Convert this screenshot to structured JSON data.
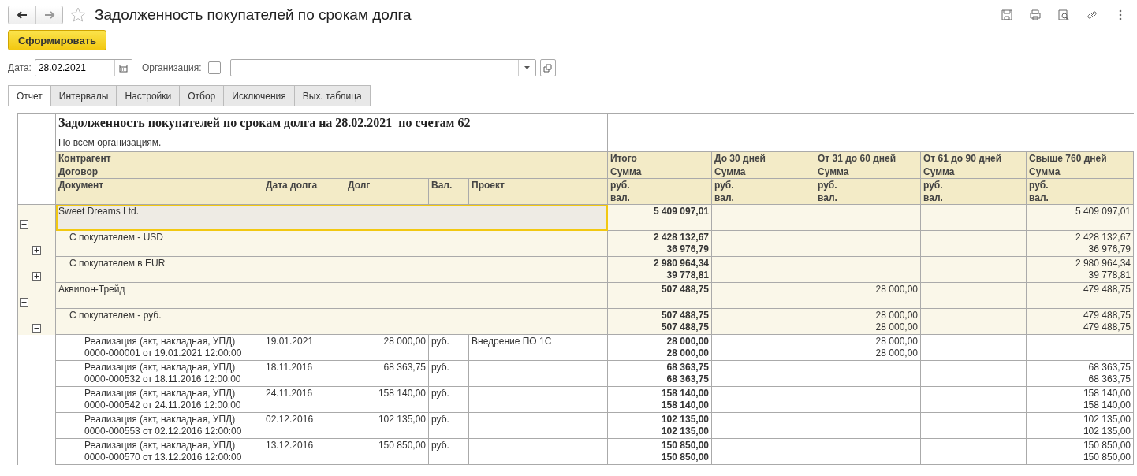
{
  "window": {
    "title": "Задолженность покупателей по срокам долга"
  },
  "generate_button": "Сформировать",
  "filters": {
    "date_label": "Дата:",
    "date_value": "28.02.2021",
    "org_label": "Организация:",
    "org_checked": false
  },
  "tabs": [
    {
      "label": "Отчет",
      "selected": true
    },
    {
      "label": "Интервалы",
      "selected": false
    },
    {
      "label": "Настройки",
      "selected": false
    },
    {
      "label": "Отбор",
      "selected": false
    },
    {
      "label": "Исключения",
      "selected": false
    },
    {
      "label": "Вых. таблица",
      "selected": false
    }
  ],
  "report": {
    "title": "Задолженность покупателей по срокам долга на 28.02.2021  по счетам 62",
    "subtitle": "По всем организациям.",
    "group_headers": [
      "Контрагент",
      "Договор"
    ],
    "detail_columns": [
      "Документ",
      "Дата долга",
      "Долг",
      "Вал.",
      "Проект"
    ],
    "amount_columns": [
      {
        "title": "Итого",
        "measure": "Сумма",
        "units": [
          "руб.",
          "вал."
        ]
      },
      {
        "title": "До 30 дней",
        "measure": "Сумма",
        "units": [
          "руб.",
          "вал."
        ]
      },
      {
        "title": "От 31 до 60 дней",
        "measure": "Сумма",
        "units": [
          "руб.",
          "вал."
        ]
      },
      {
        "title": "От 61 до 90 дней",
        "measure": "Сумма",
        "units": [
          "руб.",
          "вал."
        ]
      },
      {
        "title": "Свыше 760 дней",
        "measure": "Сумма",
        "units": [
          "руб.",
          "вал."
        ]
      }
    ],
    "rows": [
      {
        "kind": "counterparty",
        "name": "Sweet Dreams Ltd.",
        "expanded": true,
        "selected": true,
        "total": [
          "5 409 097,01"
        ],
        "over_760_days": [
          "5 409 097,01"
        ]
      },
      {
        "kind": "contract",
        "name": "С покупателем - USD",
        "expanded": false,
        "selected": false,
        "total": [
          "2 428 132,67",
          "36 976,79"
        ],
        "over_760_days": [
          "2 428 132,67",
          "36 976,79"
        ]
      },
      {
        "kind": "contract",
        "name": "С покупателем в EUR",
        "expanded": false,
        "selected": false,
        "total": [
          "2 980 964,34",
          "39 778,81"
        ],
        "over_760_days": [
          "2 980 964,34",
          "39 778,81"
        ]
      },
      {
        "kind": "counterparty",
        "name": "Аквилон-Трейд",
        "expanded": true,
        "selected": false,
        "total": [
          "507 488,75"
        ],
        "days_31_60": [
          "28 000,00"
        ],
        "over_760_days": [
          "479 488,75"
        ]
      },
      {
        "kind": "contract",
        "name": "С покупателем - руб.",
        "expanded": true,
        "selected": false,
        "total": [
          "507 488,75",
          "507 488,75"
        ],
        "days_31_60": [
          "28 000,00",
          "28 000,00"
        ],
        "over_760_days": [
          "479 488,75",
          "479 488,75"
        ]
      },
      {
        "kind": "document",
        "name": "Реализация (акт, накладная, УПД)",
        "number": "0000-000001 от 19.01.2021 12:00:00",
        "date": "19.01.2021",
        "debt": "28 000,00",
        "currency": "руб.",
        "project": "Внедрение ПО 1С",
        "total": [
          "28 000,00",
          "28 000,00"
        ],
        "days_31_60": [
          "28 000,00",
          "28 000,00"
        ]
      },
      {
        "kind": "document",
        "name": "Реализация (акт, накладная, УПД)",
        "number": "0000-000532 от 18.11.2016 12:00:00",
        "date": "18.11.2016",
        "debt": "68 363,75",
        "currency": "руб.",
        "total": [
          "68 363,75",
          "68 363,75"
        ],
        "over_760_days": [
          "68 363,75",
          "68 363,75"
        ]
      },
      {
        "kind": "document",
        "name": "Реализация (акт, накладная, УПД)",
        "number": "0000-000542 от 24.11.2016 12:00:00",
        "date": "24.11.2016",
        "debt": "158 140,00",
        "currency": "руб.",
        "total": [
          "158 140,00",
          "158 140,00"
        ],
        "over_760_days": [
          "158 140,00",
          "158 140,00"
        ]
      },
      {
        "kind": "document",
        "name": "Реализация (акт, накладная, УПД)",
        "number": "0000-000553 от 02.12.2016 12:00:00",
        "date": "02.12.2016",
        "debt": "102 135,00",
        "currency": "руб.",
        "total": [
          "102 135,00",
          "102 135,00"
        ],
        "over_760_days": [
          "102 135,00",
          "102 135,00"
        ]
      },
      {
        "kind": "document",
        "name": "Реализация (акт, накладная, УПД)",
        "number": "0000-000570 от 13.12.2016 12:00:00",
        "date": "13.12.2016",
        "debt": "150 850,00",
        "currency": "руб.",
        "total": [
          "150 850,00",
          "150 850,00"
        ],
        "over_760_days": [
          "150 850,00",
          "150 850,00"
        ]
      }
    ]
  }
}
